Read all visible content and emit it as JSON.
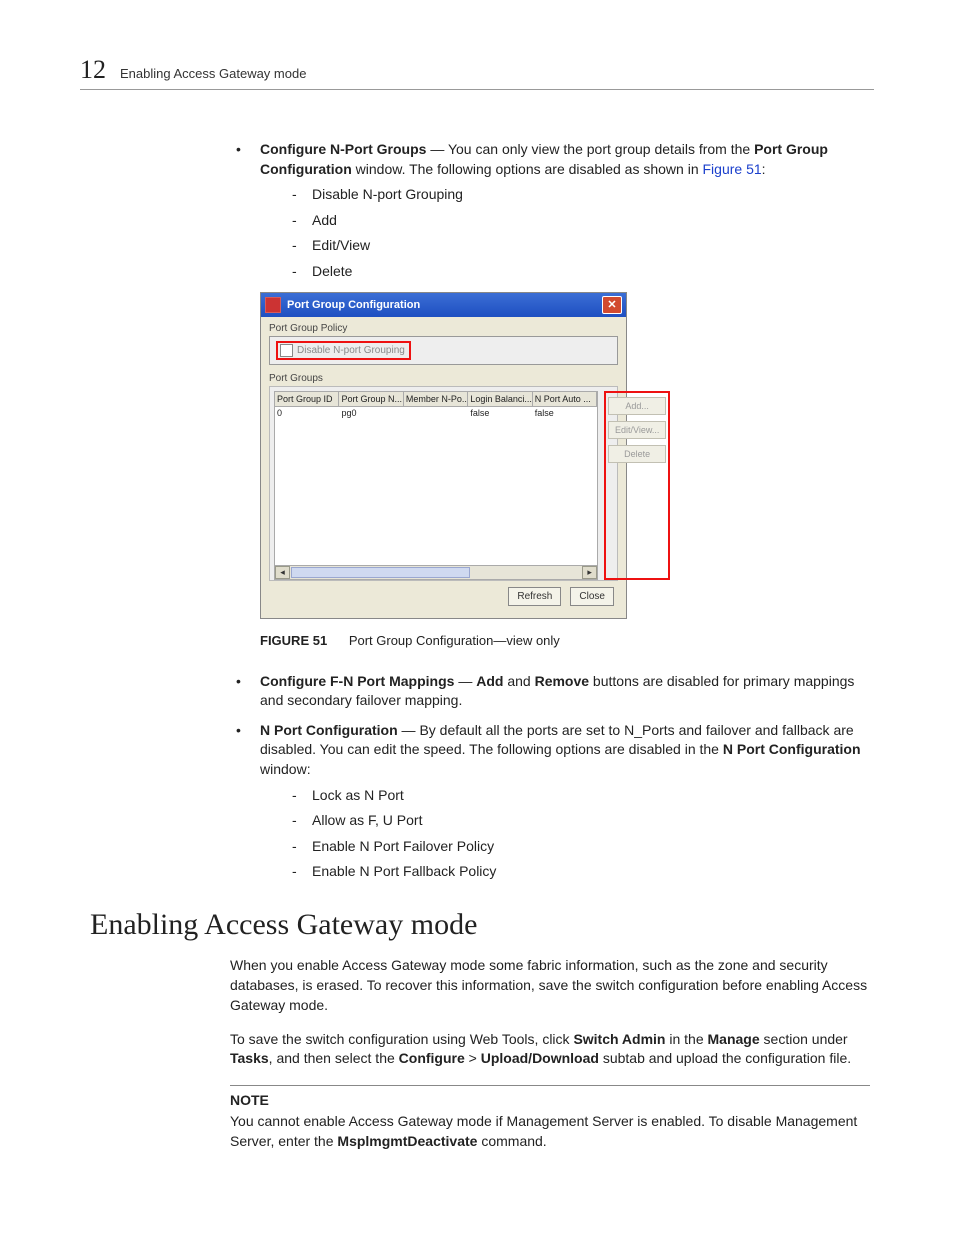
{
  "header": {
    "page_number": "12",
    "title": "Enabling Access Gateway mode"
  },
  "bullet1": {
    "label": "Configure N-Port Groups",
    "dash": " — ",
    "text1": "You can only view the port group details from the ",
    "bold_win": "Port Group Configuration",
    "text2": " window. The following options are disabled as shown in ",
    "figref": "Figure 51",
    "colon": ":",
    "items": [
      "Disable N-port Grouping",
      "Add",
      "Edit/View",
      "Delete"
    ]
  },
  "figure": {
    "num": "FIGURE 51",
    "caption": "Port Group Configuration—view only",
    "win_title": "Port Group Configuration",
    "section_policy": "Port Group Policy",
    "checkbox_label": "Disable N-port Grouping",
    "section_groups": "Port Groups",
    "cols": [
      "Port Group ID",
      "Port Group N...",
      "Member N-Po...",
      "Login Balanci...",
      "N Port Auto ..."
    ],
    "row": [
      "0",
      "pg0",
      "",
      "false",
      "false"
    ],
    "btn_add": "Add...",
    "btn_edit": "Edit/View...",
    "btn_delete": "Delete",
    "btn_refresh": "Refresh",
    "btn_close": "Close"
  },
  "bullet2": {
    "label": "Configure F-N Port Mappings",
    "dash": " — ",
    "b_add": "Add",
    "mid": " and ",
    "b_remove": "Remove",
    "rest": " buttons are disabled for primary mappings and secondary failover mapping."
  },
  "bullet3": {
    "label": "N Port Configuration",
    "dash": " — ",
    "text": "By default all the ports are set to N_Ports and failover and fallback are disabled. You can edit the speed. The following options are disabled in the ",
    "b_win": "N Port Configuration",
    "tail": " window:",
    "items": [
      "Lock as N Port",
      "Allow as F, U Port",
      "Enable N Port Failover Policy",
      "Enable N Port Fallback Policy"
    ]
  },
  "section": {
    "heading": "Enabling Access Gateway mode"
  },
  "para1": "When you enable Access Gateway mode some fabric information, such as the zone and security databases, is erased. To recover this information, save the switch configuration before enabling Access Gateway mode.",
  "para2": {
    "t1": "To save the switch configuration using Web Tools, click ",
    "b1": "Switch Admin",
    "t2": " in the ",
    "b2": "Manage",
    "t3": " section under ",
    "b3": "Tasks",
    "t4": ", and then select the ",
    "b4": "Configure",
    "t5": " > ",
    "b5": "Upload/Download",
    "t6": " subtab and upload the configuration file."
  },
  "note": {
    "head": "NOTE",
    "t1": "You cannot enable Access Gateway mode if Management Server is enabled. To disable Management Server, enter the ",
    "cmd": "MsplmgmtDeactivate",
    "t2": " command."
  }
}
